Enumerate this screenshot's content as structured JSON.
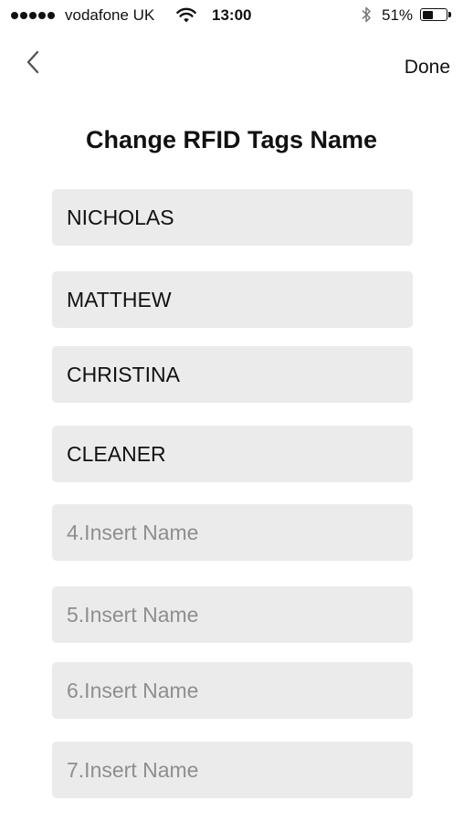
{
  "status_bar": {
    "carrier": "vodafone UK",
    "time": "13:00",
    "battery_percent": "51%",
    "battery_level": 0.51,
    "icons": [
      "signal-dots-icon",
      "wifi-icon",
      "bluetooth-icon",
      "battery-icon"
    ]
  },
  "nav": {
    "back_icon": "chevron-left-icon",
    "done_label": "Done"
  },
  "page_title": "Change RFID Tags Name",
  "fields": [
    {
      "value": "NICHOLAS",
      "placeholder": ""
    },
    {
      "value": "MATTHEW",
      "placeholder": ""
    },
    {
      "value": "CHRISTINA",
      "placeholder": ""
    },
    {
      "value": "CLEANER",
      "placeholder": ""
    },
    {
      "value": "",
      "placeholder": "4.Insert Name"
    },
    {
      "value": "",
      "placeholder": "5.Insert Name"
    },
    {
      "value": "",
      "placeholder": "6.Insert Name"
    },
    {
      "value": "",
      "placeholder": "7.Insert Name"
    }
  ]
}
